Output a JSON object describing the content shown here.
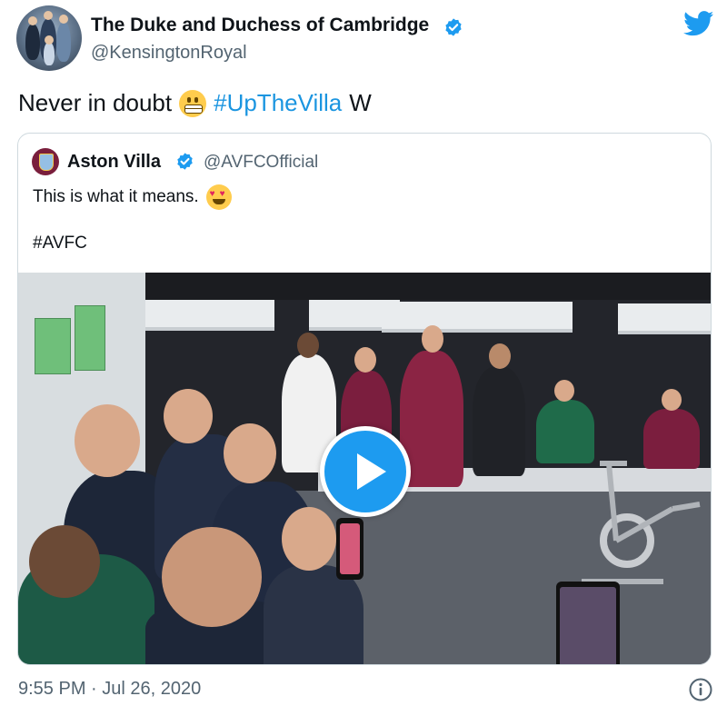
{
  "author": {
    "display_name": "The Duke and Duchess of Cambridge",
    "handle": "@KensingtonRoyal",
    "verified": true
  },
  "tweet": {
    "text_before": "Never in doubt",
    "emoji": "grimacing-face",
    "hashtag": "#UpTheVilla",
    "text_after": "W"
  },
  "quoted_tweet": {
    "display_name": "Aston Villa",
    "handle": "@AVFCOfficial",
    "verified": true,
    "text": "This is what it means.",
    "emoji": "heart-eyes-face",
    "tag": "#AVFC",
    "media": {
      "type": "video",
      "play_icon": "play-icon"
    }
  },
  "footer": {
    "timestamp": "9:55 PM · Jul 26, 2020",
    "info_icon": "info-icon"
  },
  "colors": {
    "link_blue": "#1b95e0",
    "twitter_blue": "#1d9bf0",
    "verified_blue": "#1d9bf0",
    "secondary_text": "#536471"
  }
}
